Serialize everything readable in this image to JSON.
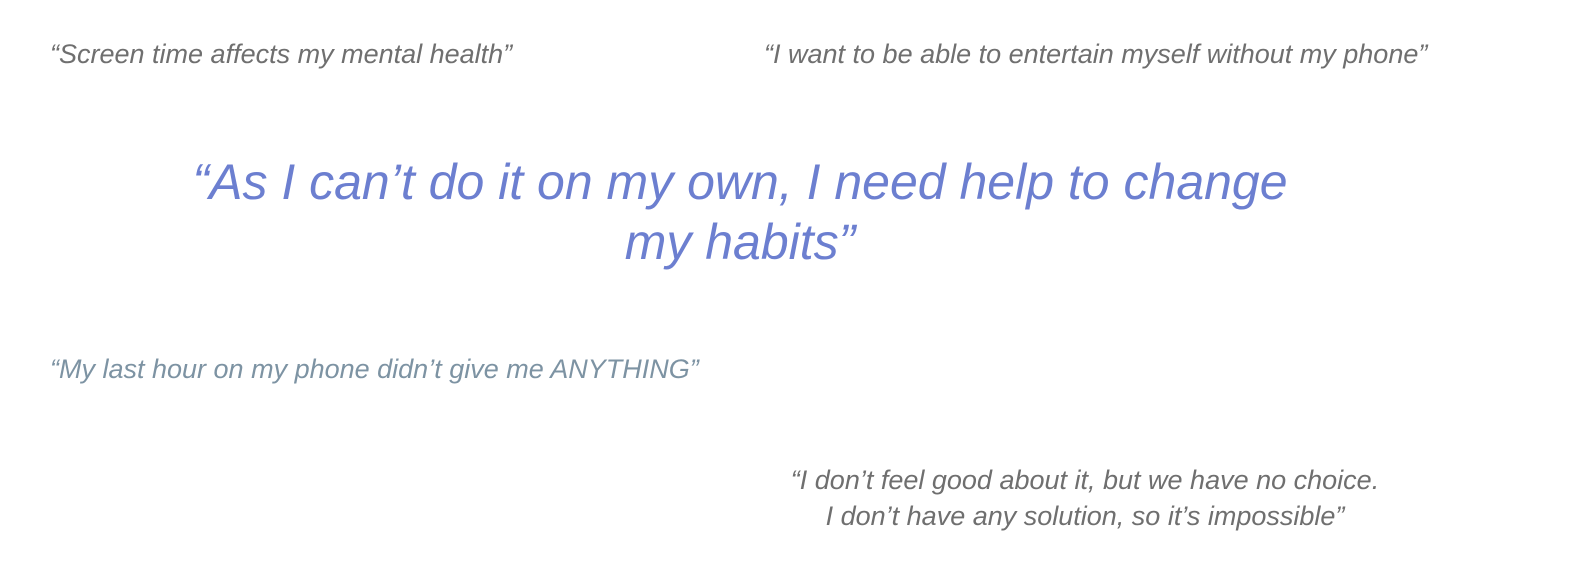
{
  "quotes": {
    "screen_time": "“Screen time affects my mental health”",
    "entertain": "“I want to be able to entertain myself without my phone”",
    "main": {
      "line1": "“As I can’t do it on my own, I need help to change",
      "line2": "my habits”"
    },
    "last_hour": "“My last hour on my phone didn’t give me ANYTHING”",
    "no_choice": {
      "line1": "“I don’t feel good about it, but we have no choice.",
      "line2": "I don’t have any solution, so it’s impossible”"
    }
  },
  "colors": {
    "gray": "#6f6f6f",
    "steel_blue": "#7d93a3",
    "periwinkle": "#6c7fd0"
  }
}
